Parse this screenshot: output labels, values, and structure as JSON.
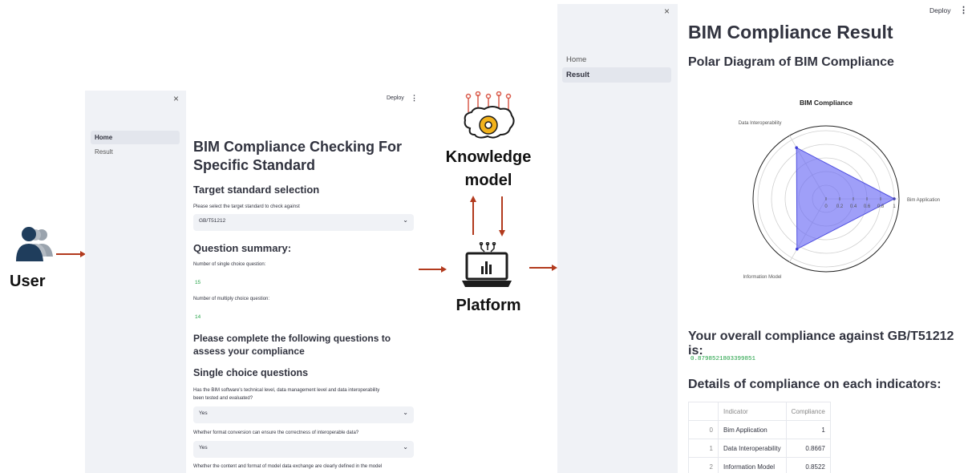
{
  "user": {
    "label": "User"
  },
  "center": {
    "knowledge_label": "Knowledge model",
    "knowledge_line1": "Knowledge",
    "knowledge_line2": "model",
    "platform_label": "Platform"
  },
  "left_app": {
    "close": "×",
    "deploy": "Deploy",
    "menu": "⋮",
    "nav": [
      {
        "label": "Home",
        "active": true
      },
      {
        "label": "Result",
        "active": false
      }
    ],
    "title_line1": "BIM Compliance Checking For",
    "title_line2": "Specific Standard",
    "target_heading": "Target standard selection",
    "target_prompt": "Please select the target standard to check against",
    "target_value": "GB/T51212",
    "summary_heading": "Question summary:",
    "single_label": "Number of single choice question:",
    "single_value": "15",
    "multi_label": "Number of multiply choice question:",
    "multi_value": "14",
    "complete_line1": "Please complete the following questions to",
    "complete_line2": "assess your compliance",
    "single_heading": "Single choice questions",
    "q1_line1": "Has the BIM software's technical level, data management level and data interoperability",
    "q1_line2": "been tested and evaluated?",
    "q1_answer": "Yes",
    "q2": "Whether format conversion can ensure the correctness of interoperable data?",
    "q2_answer": "Yes",
    "q3": "Whether the content and format of model data exchange are clearly defined in the model"
  },
  "right_app": {
    "close": "×",
    "deploy": "Deploy",
    "menu": "⋮",
    "nav": [
      {
        "label": "Home",
        "active": false
      },
      {
        "label": "Result",
        "active": true
      }
    ],
    "title": "BIM Compliance Result",
    "polar_heading": "Polar Diagram of BIM Compliance",
    "overall_heading": "Your overall compliance against GB/T51212 is:",
    "overall_value": "0.8798521803399851",
    "details_heading": "Details of compliance on each indicators:",
    "table": {
      "headers": [
        "",
        "Indicator",
        "Compliance"
      ],
      "rows": [
        [
          "0",
          "Bim Application",
          "1"
        ],
        [
          "1",
          "Data Interoperability",
          "0.8667"
        ],
        [
          "2",
          "Information Model",
          "0.8522"
        ]
      ]
    }
  },
  "chart_data": {
    "type": "radar",
    "title": "BIM Compliance",
    "categories": [
      "Bim Application",
      "Data Interoperability",
      "Information Model"
    ],
    "values": [
      1,
      0.8667,
      0.8522
    ],
    "radial_ticks": [
      "0",
      "0.2",
      "0.4",
      "0.6",
      "0.8",
      "1"
    ],
    "rlim": [
      0,
      1
    ],
    "fill_color": "#6c6cf5",
    "grid": true
  },
  "colors": {
    "arrow": "#b23a1d",
    "accent_green": "#1a9e3f",
    "sidebar_bg": "#f0f2f6"
  }
}
